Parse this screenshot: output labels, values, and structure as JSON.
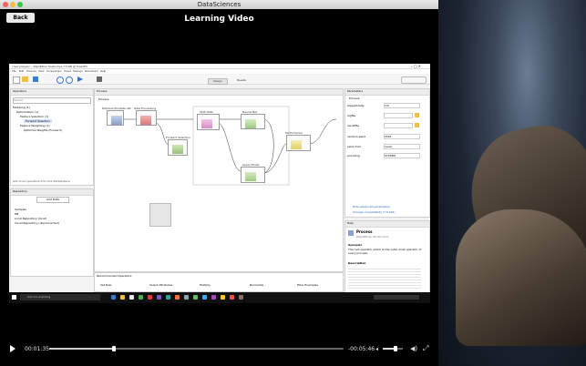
{
  "app": {
    "window_title": "DataSciences",
    "back_label": "Back",
    "video_title": "Learning Video"
  },
  "video": {
    "elapsed": "00:01:35",
    "remaining": "-00:05:46",
    "progress_fraction": 0.22,
    "volume_fraction": 0.62
  },
  "rapidminer": {
    "title": "<new process> – RapidMiner Studio Free 7.6.000 @ SmartPC",
    "menu": [
      "File",
      "Edit",
      "Process",
      "View",
      "Connections",
      "Cloud",
      "Settings",
      "Extensions",
      "Help"
    ],
    "tabs": {
      "design": "Design",
      "results": "Results"
    },
    "operators": {
      "header": "Operators",
      "search_placeholder": "Search",
      "tree": [
        "Modeling (1)",
        "Optimization (1)",
        "Feature Selection (1)",
        "Forward Selection",
        "Feature Weighting (1)",
        "Optimize Weights (Forward)"
      ],
      "marketplace": "Get more operators from the Marketplace"
    },
    "repository": {
      "header": "Repository",
      "add_data": "Add Data",
      "items": [
        "Samples",
        "DB",
        "Local Repository (local)",
        "Cloud Repository (disconnected)"
      ]
    },
    "process": {
      "header": "Process",
      "breadcrumb": "Process",
      "nodes": [
        "Retrieve Prostate dat",
        "Data Processing",
        "Forward Selection",
        "Split Data",
        "Neural Net",
        "Apply Model",
        "Performance"
      ]
    },
    "parameters": {
      "header": "Parameters",
      "subheader": "Process",
      "rows": [
        {
          "label": "logverbosity",
          "value": "init"
        },
        {
          "label": "logfile",
          "value": ""
        },
        {
          "label": "resultfile",
          "value": ""
        },
        {
          "label": "random seed",
          "value": "2001"
        },
        {
          "label": "send mail",
          "value": "never"
        },
        {
          "label": "encoding",
          "value": "SYSTEM"
        }
      ],
      "hide_advanced": "Hide advanced parameters",
      "change_compat": "Change compatibility (7.6.001)"
    },
    "help": {
      "header": "Help",
      "title": "Process",
      "subtitle": "RapidMiner Studio Core",
      "synopsis_title": "Synopsis",
      "synopsis": "The root operator which is the outer most operator of every process.",
      "description_title": "Description"
    },
    "recommended": {
      "header": "Recommended Operators",
      "items": [
        "Set Role",
        "Select Attributes",
        "Multiply",
        "Normalize",
        "Filter Examples"
      ]
    }
  },
  "windows_taskbar": {
    "search_placeholder": "Ask me anything"
  }
}
